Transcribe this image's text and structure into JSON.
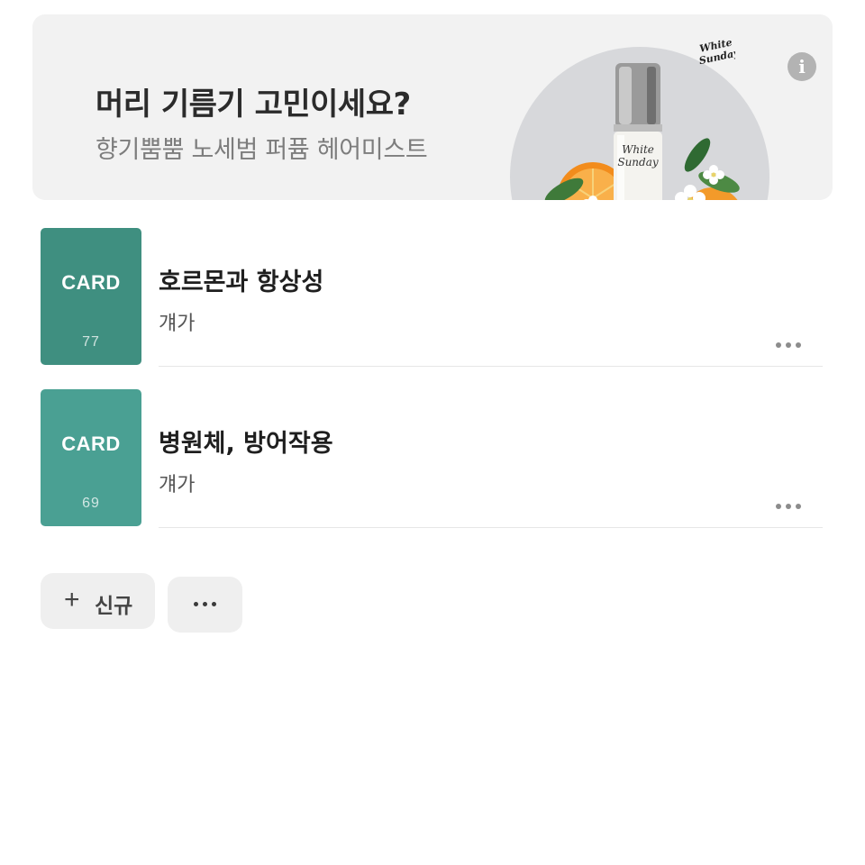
{
  "ad": {
    "headline": "머리 기름기 고민이세요?",
    "subline": "향기뿜뿜 노세범 퍼퓸 헤어미스트",
    "info_icon_glyph": "i",
    "image": "hair-mist-bottle-with-orange-and-flowers",
    "logo_text_line1": "White",
    "logo_text_line2": "Sunday",
    "colors": {
      "background": "#f2f2f2",
      "circle": "#d7d8db"
    }
  },
  "cards": [
    {
      "thumb_label": "CARD",
      "thumb_count": "77",
      "thumb_color": "#3f8f80",
      "title": "호르몬과 항상성",
      "subtitle": "걔가"
    },
    {
      "thumb_label": "CARD",
      "thumb_count": "69",
      "thumb_color": "#4aa093",
      "title": "병원체, 방어작용",
      "subtitle": "걔가"
    }
  ],
  "buttons": {
    "new_icon": "+",
    "new_label": "신규",
    "more_icon": "more-horizontal-icon"
  }
}
